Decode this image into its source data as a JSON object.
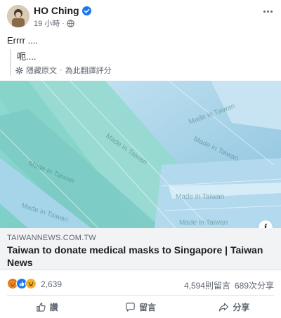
{
  "post": {
    "author": "HO Ching",
    "time": "19 小時",
    "text": "Errrr ....",
    "translation": {
      "text": "呃....",
      "hide_label": "隱藏原文",
      "separator": "·",
      "rate_label": "為此翻譯評分"
    }
  },
  "link_preview": {
    "image_texts": [
      "Made in Taiwan",
      "Made in Taiwan",
      "Made in Taiwan",
      "Made in Taiwan",
      "Made in Taiwan",
      "Made in Taiwan",
      "Made in Taiwan"
    ],
    "domain": "TAIWANNEWS.COM.TW",
    "title": "Taiwan to donate medical masks to Singapore | Taiwan News",
    "info_glyph": "i"
  },
  "engagement": {
    "reaction_icons": [
      "angry-reaction-icon",
      "like-reaction-icon",
      "haha-reaction-icon"
    ],
    "reaction_count": "2,639",
    "comments": "4,594則留言",
    "shares": "689次分享"
  },
  "actions": {
    "like": "讚",
    "comment": "留言",
    "share": "分享"
  },
  "colors": {
    "text": "#1c1e21",
    "secondary": "#606770",
    "verified": "#1877f2",
    "mask_teal": "#7fd0c8",
    "mask_blue": "#a9d3ea",
    "caption_bg": "#f2f3f5"
  }
}
